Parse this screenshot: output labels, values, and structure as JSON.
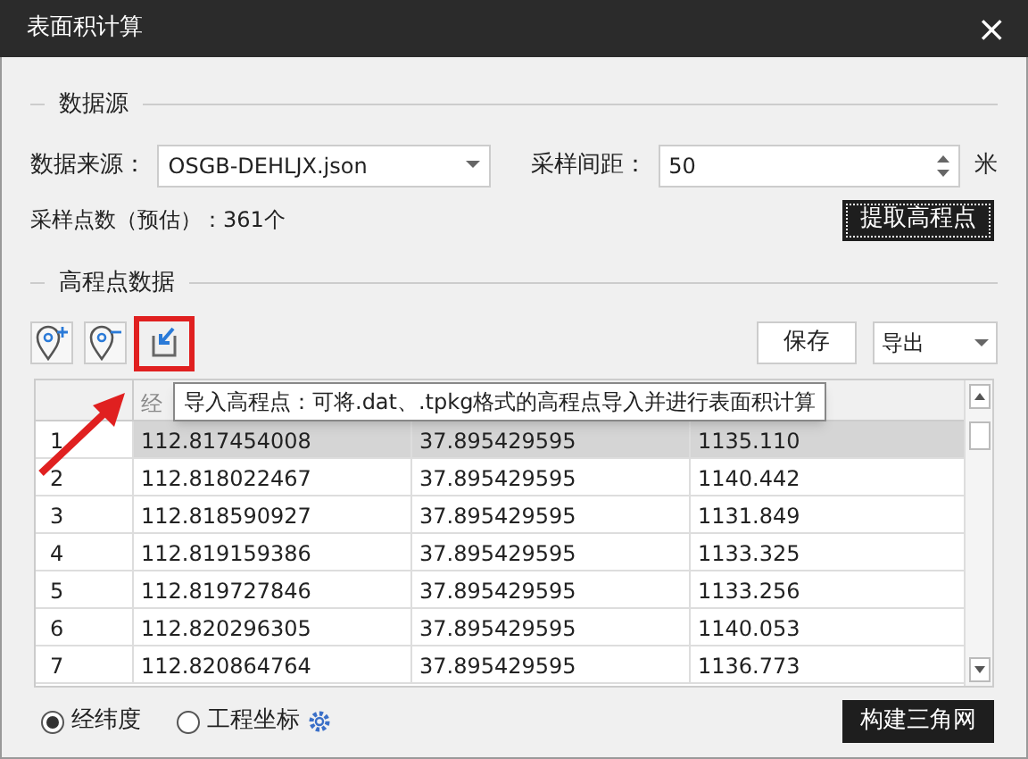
{
  "window": {
    "title": "表面积计算",
    "close": "×"
  },
  "source_section": {
    "title": "数据源",
    "source_label": "数据来源：",
    "source_value": "OSGB-DEHLJX.json",
    "interval_label": "采样间距：",
    "interval_value": "50",
    "unit": "米",
    "estimate": "采样点数（预估）：361个",
    "extract_button": "提取高程点"
  },
  "points_section": {
    "title": "高程点数据",
    "save_button": "保存",
    "export_value": "导出",
    "tooltip": "导入高程点：可将.dat、.tpkg格式的高程点导入并进行表面积计算"
  },
  "table": {
    "columns": [
      "经"
    ],
    "rows": [
      {
        "index": "1",
        "lon": "112.817454008",
        "lat": "37.895429595",
        "elev": "1135.110",
        "selected": true
      },
      {
        "index": "2",
        "lon": "112.818022467",
        "lat": "37.895429595",
        "elev": "1140.442",
        "selected": false
      },
      {
        "index": "3",
        "lon": "112.818590927",
        "lat": "37.895429595",
        "elev": "1131.849",
        "selected": false
      },
      {
        "index": "4",
        "lon": "112.819159386",
        "lat": "37.895429595",
        "elev": "1133.325",
        "selected": false
      },
      {
        "index": "5",
        "lon": "112.819727846",
        "lat": "37.895429595",
        "elev": "1133.256",
        "selected": false
      },
      {
        "index": "6",
        "lon": "112.820296305",
        "lat": "37.895429595",
        "elev": "1140.053",
        "selected": false
      },
      {
        "index": "7",
        "lon": "112.820864764",
        "lat": "37.895429595",
        "elev": "1136.773",
        "selected": false
      }
    ]
  },
  "coordinate_options": [
    {
      "label": "经纬度",
      "selected": true
    },
    {
      "label": "工程坐标",
      "selected": false
    }
  ],
  "build_button": "构建三角网"
}
